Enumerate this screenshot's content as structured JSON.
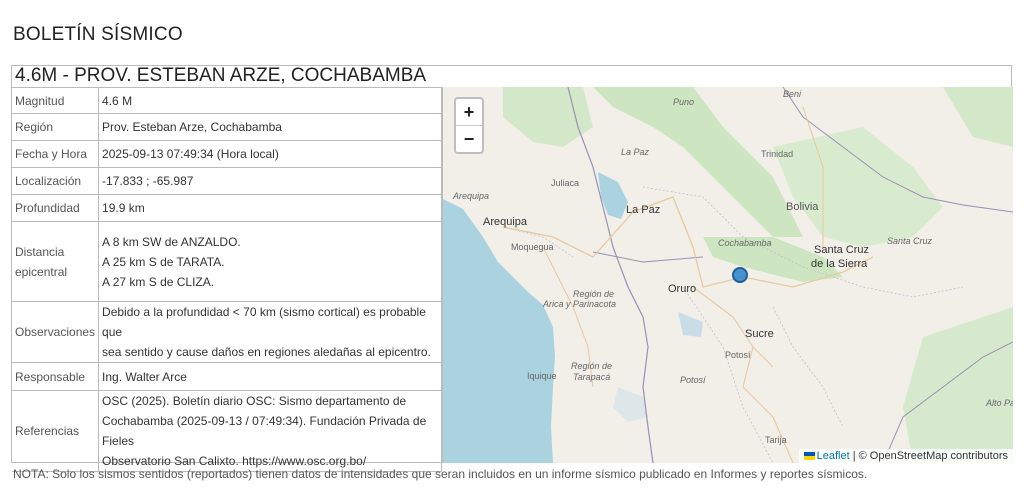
{
  "page_title": "BOLETÍN SÍSMICO",
  "event_title": "4.6M - PROV. ESTEBAN ARZE, COCHABAMBA",
  "rows": {
    "magnitud": {
      "label": "Magnitud",
      "value": "4.6 M"
    },
    "region": {
      "label": "Región",
      "value": "Prov. Esteban Arze, Cochabamba"
    },
    "fecha": {
      "label": "Fecha y Hora",
      "value": "2025-09-13 07:49:34 (Hora local)"
    },
    "localizacion": {
      "label": "Localización",
      "value": "-17.833 ; -65.987"
    },
    "profundidad": {
      "label": "Profundidad",
      "value": "19.9 km"
    },
    "distancia": {
      "label_1": "Distancia",
      "label_2": "epicentral",
      "lines": [
        "A 8 km SW de ANZALDO.",
        "A 25 km S de TARATA.",
        "A 27 km S de CLIZA."
      ]
    },
    "observaciones": {
      "label": "Observaciones",
      "lines": [
        "Debido a la profundidad < 70 km (sismo cortical) es probable que",
        "sea sentido y cause daños en regiones aledañas al epicentro."
      ]
    },
    "responsable": {
      "label": "Responsable",
      "value": "Ing. Walter Arce"
    },
    "referencias": {
      "label": "Referencias",
      "lines": [
        "OSC (2025). Boletín diario OSC: Sismo departamento de",
        "Cochabamba (2025-09-13 / 07:49:34). Fundación Privada de Fieles",
        "Observatorio San Calixto. https://www.osc.org.bo/"
      ]
    }
  },
  "map": {
    "zoom_in": "+",
    "zoom_out": "−",
    "attribution_link": "Leaflet",
    "attribution_text": "| © OpenStreetMap contributors",
    "marker_color": "#2a81cb",
    "labels": {
      "bolivia": "Bolivia",
      "la_paz": "La Paz",
      "arequipa": "Arequipa",
      "arequipa_region": "Arequipa",
      "juliaca": "Juliaca",
      "moquegua": "Moquegua",
      "trinidad": "Trinidad",
      "cochabamba": "Cochabamba",
      "santa_cruz_1": "Santa Cruz",
      "santa_cruz_2": "de la Sierra",
      "santa_cruz_region": "Santa Cruz",
      "oruro": "Oruro",
      "sucre": "Sucre",
      "potosi_city": "Potosí",
      "potosi_region": "Potosí",
      "arica_1": "Región de",
      "arica_2": "Arica y Parinacota",
      "tarapaca_1": "Región de",
      "tarapaca_2": "Tarapacá",
      "iquique": "Iquique",
      "tarija": "Tarija",
      "alto_pa": "Alto Pa",
      "la_paz_region": "La Paz",
      "puno": "Puno",
      "beni": "Beni"
    }
  },
  "note": "NOTA: Solo los sismos sentidos (reportados) tienen datos de intensidades que seran incluidos en un informe sísmico publicado en Informes y reportes sísmicos."
}
